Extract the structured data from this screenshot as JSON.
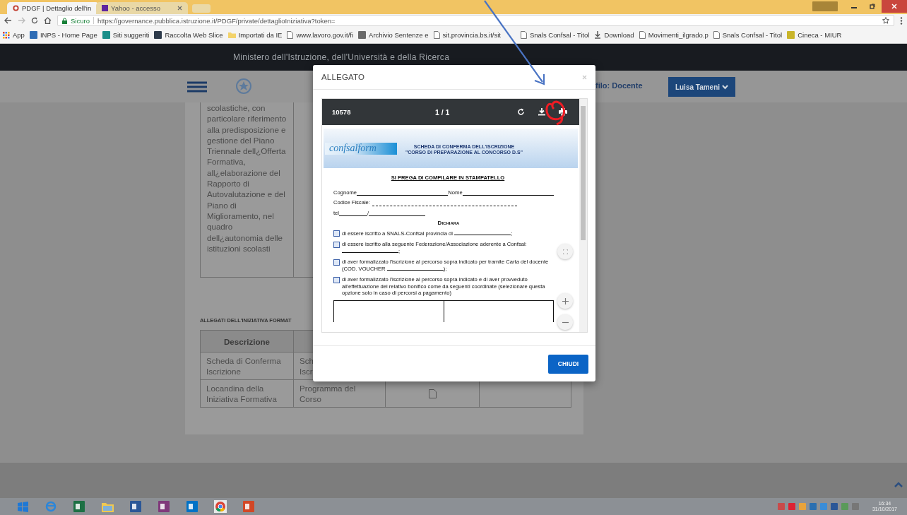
{
  "browser": {
    "tabs": [
      {
        "title": "PDGF | Dettaglio dell'in",
        "kind": "ring",
        "selected": true
      },
      {
        "title": "Yahoo - accesso",
        "kind": "square",
        "selected": false
      }
    ],
    "security_label": "Sicuro",
    "url": "https://governance.pubblica.istruzione.it/PDGF/private/dettaglioIniziativa?token=",
    "bookmarks": [
      {
        "label": "App",
        "kind": "apps"
      },
      {
        "label": "INPS - Home Page",
        "kind": "site",
        "color": "#2f6db5"
      },
      {
        "label": "Siti suggeriti",
        "kind": "site",
        "color": "#1b8f8a"
      },
      {
        "label": "Raccolta Web Slice",
        "kind": "site",
        "color": "#2d3a4a"
      },
      {
        "label": "Importati da IE",
        "kind": "folder"
      },
      {
        "label": "www.lavoro.gov.it/fi",
        "kind": "page"
      },
      {
        "label": "Archivio Sentenze e",
        "kind": "site",
        "color": "#6b6b6b"
      },
      {
        "label": "sit.provincia.bs.it/sit",
        "kind": "page"
      },
      {
        "label": "Snals Confsal - Titol",
        "kind": "page"
      },
      {
        "label": "Download",
        "kind": "download"
      },
      {
        "label": "Movimenti_ilgrado.p",
        "kind": "page"
      },
      {
        "label": "Snals Confsal - Titol",
        "kind": "page"
      },
      {
        "label": "Cineca - MIUR",
        "kind": "site",
        "color": "#c9b52a"
      }
    ]
  },
  "header": {
    "ministry": "Ministero dell'Istruzione, dell'Università e della Ricerca",
    "profile": "filo: Docente",
    "user_button": "Luisa Tameni"
  },
  "content": {
    "description": "scolastiche, con particolare riferimento alla predisposizione e gestione del Piano Triennale dell¿Offerta Formativa, all¿elaborazione del Rapporto di Autovalutazione e del Piano di Miglioramento, nel quadro dell¿autonomia delle istituzioni scolasti",
    "attachments_heading": "ALLEGATI DELL'INIZIATIVA FORMAT",
    "table": {
      "columns": [
        "Descrizione"
      ],
      "rows": [
        {
          "cells": [
            "Scheda di Conferma Iscrizione",
            "Sch\nIscr"
          ]
        },
        {
          "cells": [
            "Locandina della Iniziativa Formativa",
            "Programma del Corso"
          ],
          "file": true
        }
      ]
    }
  },
  "dialog": {
    "title": "ALLEGATO",
    "viewer": {
      "document": "10578",
      "page": "1 / 1"
    },
    "pdf": {
      "logo": "confsalform",
      "title_lines": [
        "SCHEDA DI CONFERMA DELL'ISCRIZIONE",
        "\"CORSO DI PREPARAZIONE AL CONCORSO D.S\""
      ],
      "notice": "SI PREGA DI COMPILARE IN STAMPATELLO",
      "fields": [
        {
          "kind": "pair",
          "labels": [
            "Cognome",
            "Nome"
          ]
        },
        {
          "kind": "dashed",
          "labels": [
            "Codice Fiscale:"
          ]
        },
        {
          "kind": "phone",
          "labels": [
            "tel",
            "/"
          ]
        }
      ],
      "declare": "Dichiara",
      "items": [
        {
          "text": "di essere iscritto a SNALS-Confsal provincia di",
          "blank": true,
          "suffix": ";",
          "checked": false
        },
        {
          "text": "di essere iscritto alla seguente Federazione/Associazione aderente a Confsal:",
          "blank": true,
          "suffix": ";",
          "checked": false
        },
        {
          "text": "di aver formalizzato l'iscrizione al percorso sopra indicato per tramite Carta del docente (COD. VOUCHER",
          "blank": true,
          "suffix": ");",
          "checked": false
        },
        {
          "text": "di aver formalizzato l'iscrizione al percorso sopra indicato e di aver provveduto all'effettuazione del relativo bonifico come da seguenti coordinate (selezionare questa opzione solo in caso di percorsi a pagamento)",
          "blank": false,
          "checked": false
        }
      ]
    },
    "close_button": "CHIUDI"
  },
  "taskbar": {
    "apps": [
      {
        "kind": "start"
      },
      {
        "kind": "globe"
      },
      {
        "kind": "tile",
        "color": "#1d7044"
      },
      {
        "kind": "folder"
      },
      {
        "kind": "tile",
        "color": "#2b5797"
      },
      {
        "kind": "tile",
        "color": "#80397b"
      },
      {
        "kind": "tile",
        "color": "#0072c6"
      },
      {
        "kind": "chrome"
      },
      {
        "kind": "tile",
        "color": "#d24726"
      }
    ],
    "time": "16:34",
    "date": "31/10/2017"
  }
}
